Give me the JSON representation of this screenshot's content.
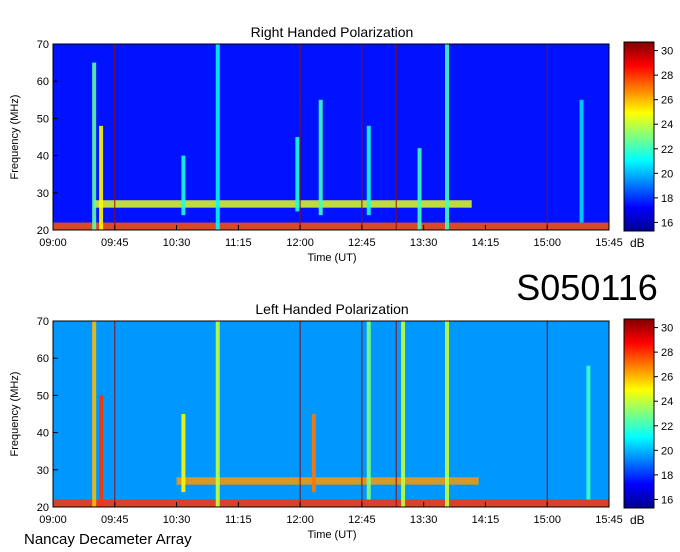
{
  "chart_data": [
    {
      "type": "heatmap",
      "title": "Right Handed Polarization",
      "xlabel": "Time (UT)",
      "ylabel": "Frequency (MHz)",
      "x_ticks": [
        "09:00",
        "09:45",
        "10:30",
        "11:15",
        "12:00",
        "12:45",
        "13:30",
        "14:15",
        "15:00",
        "15:45"
      ],
      "y_ticks": [
        "20",
        "30",
        "40",
        "50",
        "60",
        "70"
      ],
      "xlim": [
        "09:00",
        "15:45"
      ],
      "ylim": [
        20,
        70
      ],
      "colorbar": {
        "label": "dB",
        "ticks": [
          "16",
          "18",
          "20",
          "22",
          "24",
          "26",
          "28",
          "30"
        ],
        "range": [
          15.3,
          30.7
        ],
        "colormap": "jet"
      },
      "background_level_db": 17.5,
      "bursts": [
        {
          "time": "09:30",
          "f_low": 20,
          "f_high": 65,
          "level_db": 22.5
        },
        {
          "time": "09:35",
          "f_low": 20,
          "f_high": 48,
          "level_db": 25
        },
        {
          "time": "10:35",
          "f_low": 24,
          "f_high": 40,
          "level_db": 21.5
        },
        {
          "time": "11:00",
          "f_low": 20,
          "f_high": 70,
          "level_db": 21
        },
        {
          "time": "11:58",
          "f_low": 25,
          "f_high": 45,
          "level_db": 21.5
        },
        {
          "time": "12:15",
          "f_low": 24,
          "f_high": 55,
          "level_db": 22
        },
        {
          "time": "12:50",
          "f_low": 24,
          "f_high": 48,
          "level_db": 21.5
        },
        {
          "time": "13:27",
          "f_low": 20,
          "f_high": 42,
          "level_db": 22
        },
        {
          "time": "13:47",
          "f_low": 20,
          "f_high": 70,
          "level_db": 22
        },
        {
          "time": "15:25",
          "f_low": 22,
          "f_high": 55,
          "level_db": 20.5
        }
      ],
      "bands": [
        {
          "time_start": "09:30",
          "time_end": "14:05",
          "f_low": 26,
          "f_high": 28,
          "level_db": 24.5
        },
        {
          "time_start": "09:00",
          "time_end": "15:45",
          "f_low": 20,
          "f_high": 22,
          "level_db": 27.5
        }
      ],
      "markers": [
        "09:45",
        "12:00",
        "12:45",
        "13:10",
        "15:00"
      ]
    },
    {
      "type": "heatmap",
      "title": "Left Handed Polarization",
      "xlabel": "Time (UT)",
      "ylabel": "Frequency (MHz)",
      "x_ticks": [
        "09:00",
        "09:45",
        "10:30",
        "11:15",
        "12:00",
        "12:45",
        "13:30",
        "14:15",
        "15:00",
        "15:45"
      ],
      "y_ticks": [
        "20",
        "30",
        "40",
        "50",
        "60",
        "70"
      ],
      "xlim": [
        "09:00",
        "15:45"
      ],
      "ylim": [
        20,
        70
      ],
      "colorbar": {
        "label": "dB",
        "ticks": [
          "16",
          "18",
          "20",
          "22",
          "24",
          "26",
          "28",
          "30"
        ],
        "range": [
          15.3,
          30.7
        ],
        "colormap": "jet"
      },
      "background_level_db": 19.5,
      "bursts": [
        {
          "time": "09:30",
          "f_low": 20,
          "f_high": 70,
          "level_db": 26
        },
        {
          "time": "09:35",
          "f_low": 20,
          "f_high": 50,
          "level_db": 28
        },
        {
          "time": "10:35",
          "f_low": 24,
          "f_high": 45,
          "level_db": 25
        },
        {
          "time": "11:00",
          "f_low": 20,
          "f_high": 70,
          "level_db": 24
        },
        {
          "time": "12:10",
          "f_low": 24,
          "f_high": 45,
          "level_db": 27
        },
        {
          "time": "12:50",
          "f_low": 22,
          "f_high": 70,
          "level_db": 23
        },
        {
          "time": "13:15",
          "f_low": 20,
          "f_high": 70,
          "level_db": 24
        },
        {
          "time": "13:47",
          "f_low": 20,
          "f_high": 70,
          "level_db": 24
        },
        {
          "time": "15:30",
          "f_low": 22,
          "f_high": 58,
          "level_db": 22
        }
      ],
      "bands": [
        {
          "time_start": "10:30",
          "time_end": "14:10",
          "f_low": 26,
          "f_high": 28,
          "level_db": 26.5
        },
        {
          "time_start": "09:00",
          "time_end": "15:45",
          "f_low": 20,
          "f_high": 22,
          "level_db": 28
        }
      ],
      "markers": [
        "09:45",
        "12:00",
        "12:45",
        "13:10",
        "15:00"
      ]
    }
  ],
  "date_code": "S050116",
  "instrument": "Nancay Decameter Array"
}
